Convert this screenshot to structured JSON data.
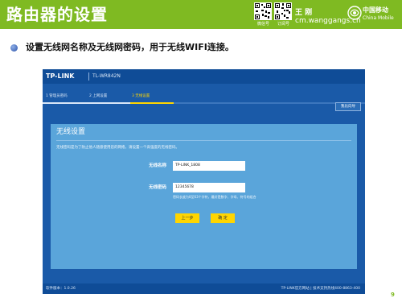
{
  "slide": {
    "title": "路由器的设置",
    "author_name": "王 刚",
    "author_site": "cm.wanggangs.cn",
    "qr_label_1": "微信号",
    "qr_label_2": "订阅号",
    "brand_name": "中国移动",
    "brand_name_en": "China Mobile",
    "bullet": "设置无线网名称及无线网密码，用于无线WIFI连接。",
    "page_number": "9",
    "header_color": "#7fba22"
  },
  "router": {
    "logo": "TP-LINK",
    "model": "TL-WR842N",
    "steps": [
      {
        "label": "1  管理员密码",
        "state": "done"
      },
      {
        "label": "2  上网设置",
        "state": "done"
      },
      {
        "label": "3  无线设置",
        "state": "active"
      }
    ],
    "help_button": "我比向导",
    "wizard": {
      "title": "无线设置",
      "description": "无线密码是为了防止他人随意使用您的网络，请设置一个高强度的无线密码。",
      "ssid_label": "无线名称",
      "ssid_value": "TP-LINK_1808",
      "password_label": "无线密码",
      "password_value": "12345678",
      "password_hint": "密码长度为8至63个字符，最好是数字、字母、符号的组合",
      "prev_button": "上一步",
      "confirm_button": "确 定"
    },
    "footer_left": "软件版本：1.0.26",
    "footer_right": "TP-LINK官方网站 | 技术支持热线400-8863-400"
  }
}
